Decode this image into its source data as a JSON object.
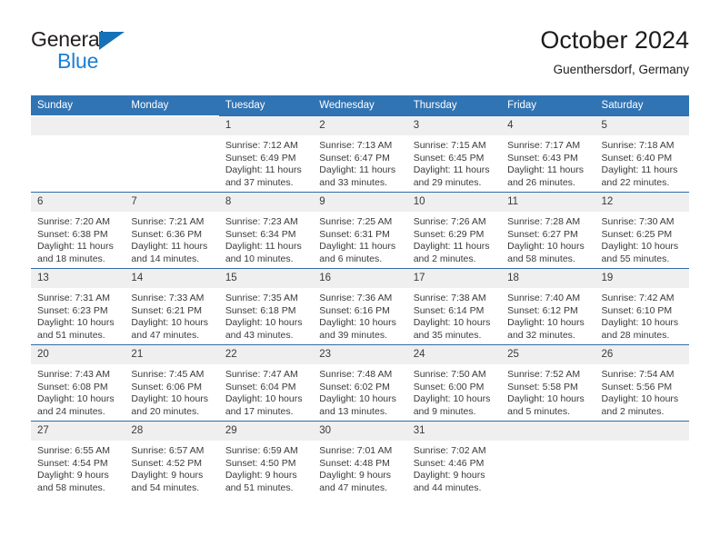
{
  "brand": {
    "word1": "General",
    "word2": "Blue",
    "triangle_color": "#1671b8",
    "blue_color": "#1b7fd4"
  },
  "header": {
    "title": "October 2024",
    "location": "Guenthersdorf, Germany"
  },
  "theme": {
    "header_bg": "#3174b4",
    "row_divider": "#2f6ca8",
    "daynum_bg": "#efefef",
    "text": "#3a3a3a"
  },
  "weekday_headers": [
    "Sunday",
    "Monday",
    "Tuesday",
    "Wednesday",
    "Thursday",
    "Friday",
    "Saturday"
  ],
  "labels": {
    "sunrise": "Sunrise:",
    "sunset": "Sunset:",
    "daylight": "Daylight:"
  },
  "weeks": [
    [
      {
        "day": "",
        "sunrise": "",
        "sunset": "",
        "daylight_line1": "",
        "daylight_line2": "",
        "empty": true
      },
      {
        "day": "",
        "sunrise": "",
        "sunset": "",
        "daylight_line1": "",
        "daylight_line2": "",
        "empty": true
      },
      {
        "day": "1",
        "sunrise": "Sunrise: 7:12 AM",
        "sunset": "Sunset: 6:49 PM",
        "daylight_line1": "Daylight: 11 hours",
        "daylight_line2": "and 37 minutes."
      },
      {
        "day": "2",
        "sunrise": "Sunrise: 7:13 AM",
        "sunset": "Sunset: 6:47 PM",
        "daylight_line1": "Daylight: 11 hours",
        "daylight_line2": "and 33 minutes."
      },
      {
        "day": "3",
        "sunrise": "Sunrise: 7:15 AM",
        "sunset": "Sunset: 6:45 PM",
        "daylight_line1": "Daylight: 11 hours",
        "daylight_line2": "and 29 minutes."
      },
      {
        "day": "4",
        "sunrise": "Sunrise: 7:17 AM",
        "sunset": "Sunset: 6:43 PM",
        "daylight_line1": "Daylight: 11 hours",
        "daylight_line2": "and 26 minutes."
      },
      {
        "day": "5",
        "sunrise": "Sunrise: 7:18 AM",
        "sunset": "Sunset: 6:40 PM",
        "daylight_line1": "Daylight: 11 hours",
        "daylight_line2": "and 22 minutes."
      }
    ],
    [
      {
        "day": "6",
        "sunrise": "Sunrise: 7:20 AM",
        "sunset": "Sunset: 6:38 PM",
        "daylight_line1": "Daylight: 11 hours",
        "daylight_line2": "and 18 minutes."
      },
      {
        "day": "7",
        "sunrise": "Sunrise: 7:21 AM",
        "sunset": "Sunset: 6:36 PM",
        "daylight_line1": "Daylight: 11 hours",
        "daylight_line2": "and 14 minutes."
      },
      {
        "day": "8",
        "sunrise": "Sunrise: 7:23 AM",
        "sunset": "Sunset: 6:34 PM",
        "daylight_line1": "Daylight: 11 hours",
        "daylight_line2": "and 10 minutes."
      },
      {
        "day": "9",
        "sunrise": "Sunrise: 7:25 AM",
        "sunset": "Sunset: 6:31 PM",
        "daylight_line1": "Daylight: 11 hours",
        "daylight_line2": "and 6 minutes."
      },
      {
        "day": "10",
        "sunrise": "Sunrise: 7:26 AM",
        "sunset": "Sunset: 6:29 PM",
        "daylight_line1": "Daylight: 11 hours",
        "daylight_line2": "and 2 minutes."
      },
      {
        "day": "11",
        "sunrise": "Sunrise: 7:28 AM",
        "sunset": "Sunset: 6:27 PM",
        "daylight_line1": "Daylight: 10 hours",
        "daylight_line2": "and 58 minutes."
      },
      {
        "day": "12",
        "sunrise": "Sunrise: 7:30 AM",
        "sunset": "Sunset: 6:25 PM",
        "daylight_line1": "Daylight: 10 hours",
        "daylight_line2": "and 55 minutes."
      }
    ],
    [
      {
        "day": "13",
        "sunrise": "Sunrise: 7:31 AM",
        "sunset": "Sunset: 6:23 PM",
        "daylight_line1": "Daylight: 10 hours",
        "daylight_line2": "and 51 minutes."
      },
      {
        "day": "14",
        "sunrise": "Sunrise: 7:33 AM",
        "sunset": "Sunset: 6:21 PM",
        "daylight_line1": "Daylight: 10 hours",
        "daylight_line2": "and 47 minutes."
      },
      {
        "day": "15",
        "sunrise": "Sunrise: 7:35 AM",
        "sunset": "Sunset: 6:18 PM",
        "daylight_line1": "Daylight: 10 hours",
        "daylight_line2": "and 43 minutes."
      },
      {
        "day": "16",
        "sunrise": "Sunrise: 7:36 AM",
        "sunset": "Sunset: 6:16 PM",
        "daylight_line1": "Daylight: 10 hours",
        "daylight_line2": "and 39 minutes."
      },
      {
        "day": "17",
        "sunrise": "Sunrise: 7:38 AM",
        "sunset": "Sunset: 6:14 PM",
        "daylight_line1": "Daylight: 10 hours",
        "daylight_line2": "and 35 minutes."
      },
      {
        "day": "18",
        "sunrise": "Sunrise: 7:40 AM",
        "sunset": "Sunset: 6:12 PM",
        "daylight_line1": "Daylight: 10 hours",
        "daylight_line2": "and 32 minutes."
      },
      {
        "day": "19",
        "sunrise": "Sunrise: 7:42 AM",
        "sunset": "Sunset: 6:10 PM",
        "daylight_line1": "Daylight: 10 hours",
        "daylight_line2": "and 28 minutes."
      }
    ],
    [
      {
        "day": "20",
        "sunrise": "Sunrise: 7:43 AM",
        "sunset": "Sunset: 6:08 PM",
        "daylight_line1": "Daylight: 10 hours",
        "daylight_line2": "and 24 minutes."
      },
      {
        "day": "21",
        "sunrise": "Sunrise: 7:45 AM",
        "sunset": "Sunset: 6:06 PM",
        "daylight_line1": "Daylight: 10 hours",
        "daylight_line2": "and 20 minutes."
      },
      {
        "day": "22",
        "sunrise": "Sunrise: 7:47 AM",
        "sunset": "Sunset: 6:04 PM",
        "daylight_line1": "Daylight: 10 hours",
        "daylight_line2": "and 17 minutes."
      },
      {
        "day": "23",
        "sunrise": "Sunrise: 7:48 AM",
        "sunset": "Sunset: 6:02 PM",
        "daylight_line1": "Daylight: 10 hours",
        "daylight_line2": "and 13 minutes."
      },
      {
        "day": "24",
        "sunrise": "Sunrise: 7:50 AM",
        "sunset": "Sunset: 6:00 PM",
        "daylight_line1": "Daylight: 10 hours",
        "daylight_line2": "and 9 minutes."
      },
      {
        "day": "25",
        "sunrise": "Sunrise: 7:52 AM",
        "sunset": "Sunset: 5:58 PM",
        "daylight_line1": "Daylight: 10 hours",
        "daylight_line2": "and 5 minutes."
      },
      {
        "day": "26",
        "sunrise": "Sunrise: 7:54 AM",
        "sunset": "Sunset: 5:56 PM",
        "daylight_line1": "Daylight: 10 hours",
        "daylight_line2": "and 2 minutes."
      }
    ],
    [
      {
        "day": "27",
        "sunrise": "Sunrise: 6:55 AM",
        "sunset": "Sunset: 4:54 PM",
        "daylight_line1": "Daylight: 9 hours",
        "daylight_line2": "and 58 minutes."
      },
      {
        "day": "28",
        "sunrise": "Sunrise: 6:57 AM",
        "sunset": "Sunset: 4:52 PM",
        "daylight_line1": "Daylight: 9 hours",
        "daylight_line2": "and 54 minutes."
      },
      {
        "day": "29",
        "sunrise": "Sunrise: 6:59 AM",
        "sunset": "Sunset: 4:50 PM",
        "daylight_line1": "Daylight: 9 hours",
        "daylight_line2": "and 51 minutes."
      },
      {
        "day": "30",
        "sunrise": "Sunrise: 7:01 AM",
        "sunset": "Sunset: 4:48 PM",
        "daylight_line1": "Daylight: 9 hours",
        "daylight_line2": "and 47 minutes."
      },
      {
        "day": "31",
        "sunrise": "Sunrise: 7:02 AM",
        "sunset": "Sunset: 4:46 PM",
        "daylight_line1": "Daylight: 9 hours",
        "daylight_line2": "and 44 minutes."
      },
      {
        "day": "",
        "sunrise": "",
        "sunset": "",
        "daylight_line1": "",
        "daylight_line2": "",
        "noday": true
      },
      {
        "day": "",
        "sunrise": "",
        "sunset": "",
        "daylight_line1": "",
        "daylight_line2": "",
        "noday": true
      }
    ]
  ]
}
